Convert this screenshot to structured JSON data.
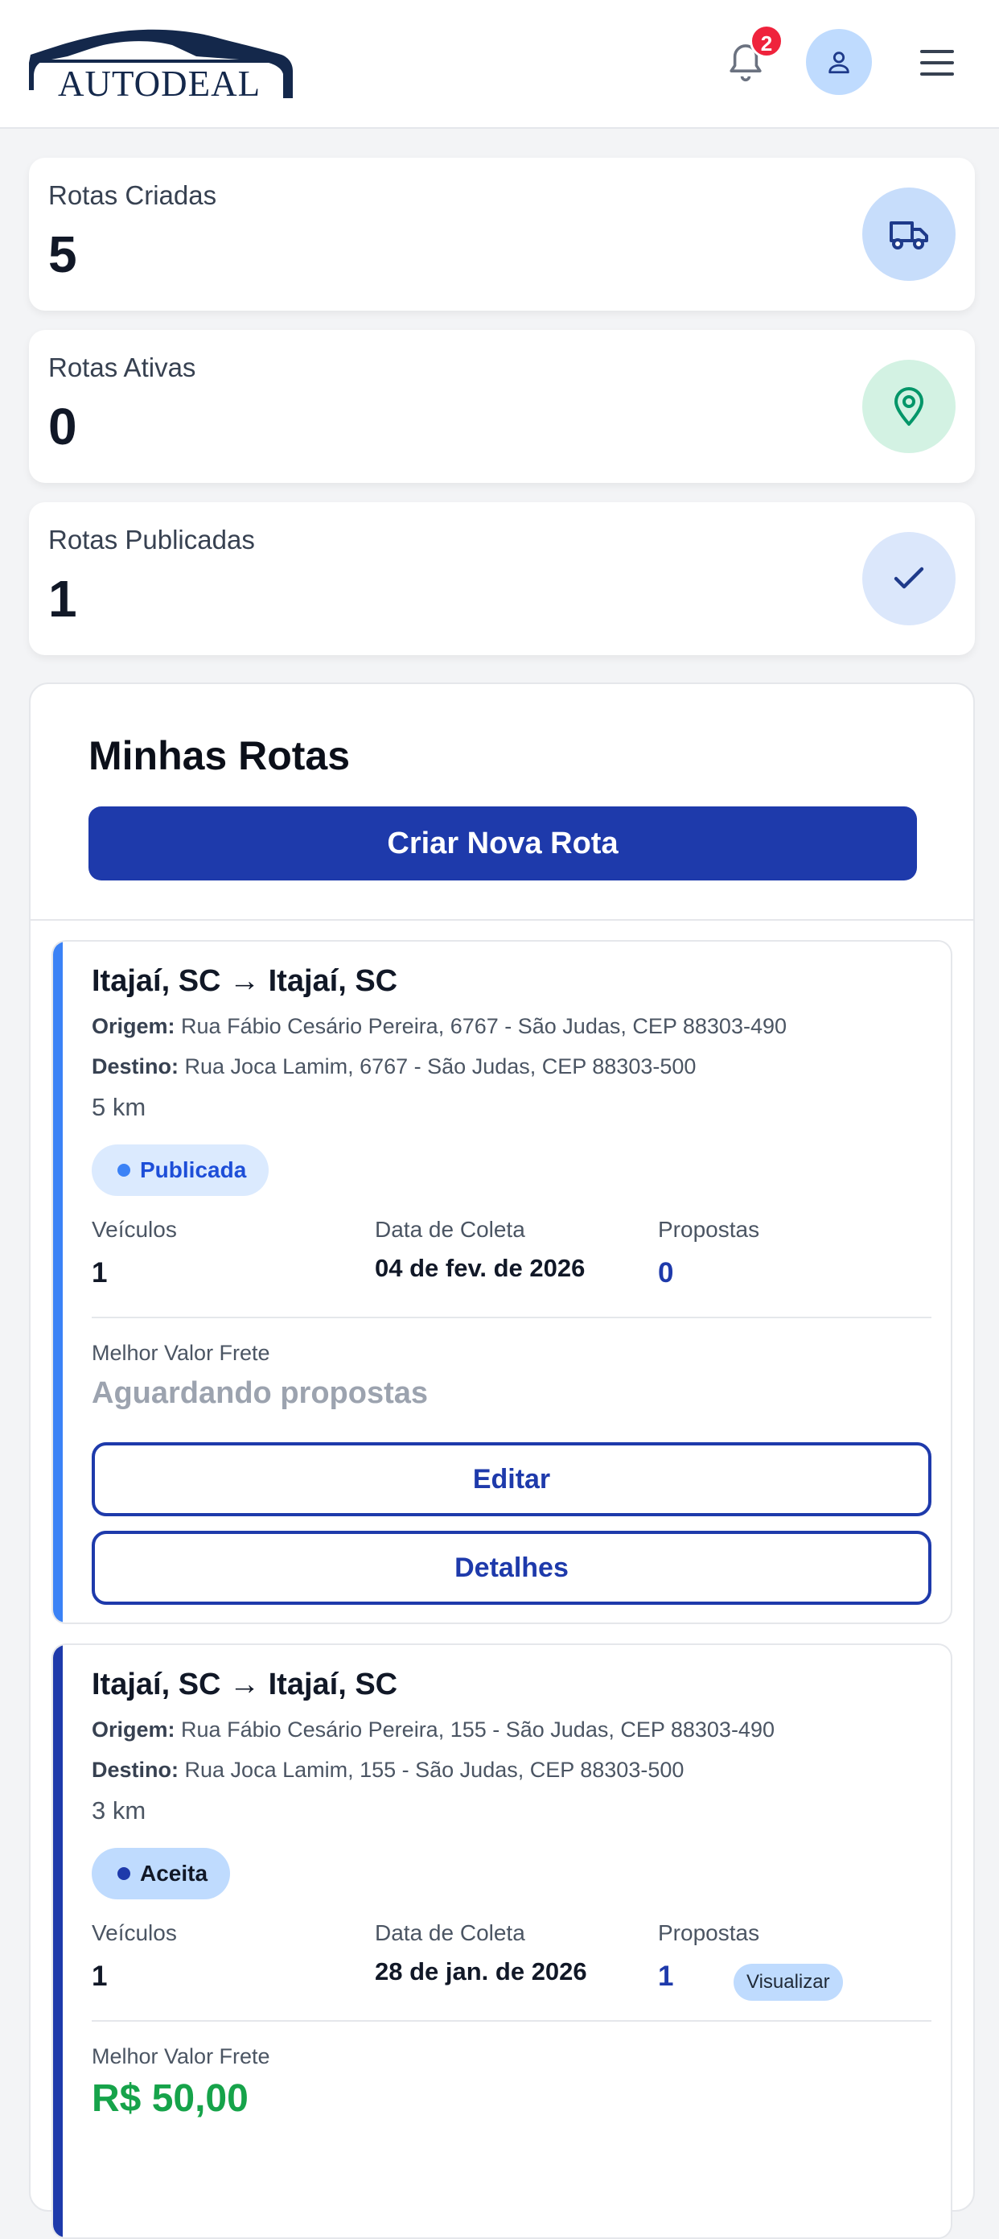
{
  "header": {
    "logo_text": "AUTODEAL",
    "notification_count": "2"
  },
  "stats": [
    {
      "label": "Rotas Criadas",
      "value": "5",
      "icon": "truck-icon",
      "icon_bg": "#c7ddfb",
      "icon_color": "#1e3a8a"
    },
    {
      "label": "Rotas Ativas",
      "value": "0",
      "icon": "map-pin-icon",
      "icon_bg": "#d3f2e3",
      "icon_color": "#059669"
    },
    {
      "label": "Rotas Publicadas",
      "value": "1",
      "icon": "check-icon",
      "icon_bg": "#dbe7fb",
      "icon_color": "#1e3a8a"
    }
  ],
  "routes_panel": {
    "title": "Minhas Rotas",
    "create_button": "Criar Nova Rota"
  },
  "labels": {
    "origin": "Origem:",
    "destination": "Destino:",
    "vehicles": "Veículos",
    "pickup_date": "Data de Coleta",
    "proposals": "Propostas",
    "best_value": "Melhor Valor Frete",
    "edit": "Editar",
    "details": "Detalhes",
    "view": "Visualizar"
  },
  "routes": [
    {
      "title": "Itajaí, SC → Itajaí, SC",
      "origin": "Rua Fábio Cesário Pereira, 6767 - São Judas, CEP 88303-490",
      "destination": "Rua Joca Lamim, 6767 - São Judas, CEP 88303-500",
      "distance": "5 km",
      "status": "Publicada",
      "status_color": "#1d4ed8",
      "status_bg": "#dbeafe",
      "status_dot": "#3b82f6",
      "accent": "#3b82f6",
      "vehicles": "1",
      "pickup_date": "04 de fev. de 2026",
      "proposals": "0",
      "best_value": "Aguardando propostas"
    },
    {
      "title": "Itajaí, SC → Itajaí, SC",
      "origin": "Rua Fábio Cesário Pereira, 155 - São Judas, CEP 88303-490",
      "destination": "Rua Joca Lamim, 155 - São Judas, CEP 88303-500",
      "distance": "3 km",
      "status": "Aceita",
      "status_color": "#111827",
      "status_bg": "#bfdbfe",
      "status_dot": "#1e3aab",
      "accent": "#1e3aab",
      "vehicles": "1",
      "pickup_date": "28 de jan. de 2026",
      "proposals": "1",
      "best_value": "R$ 50,00"
    }
  ]
}
